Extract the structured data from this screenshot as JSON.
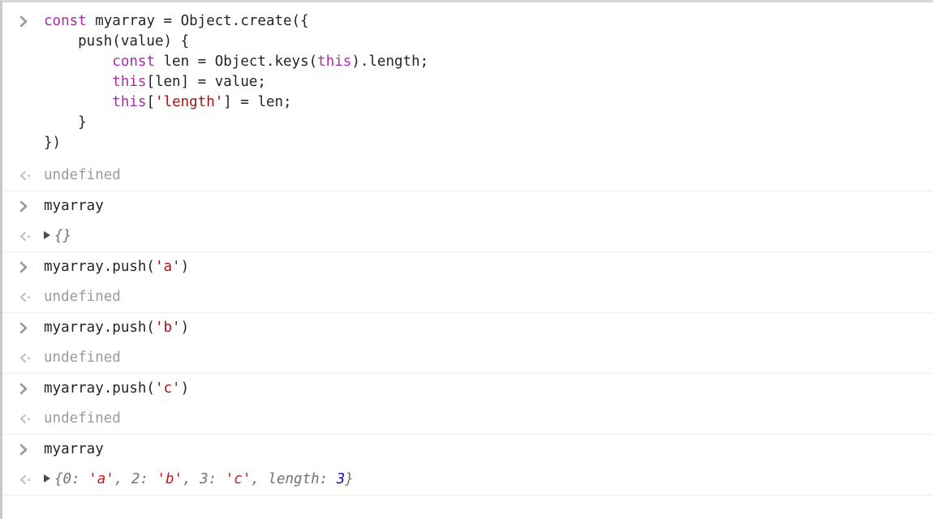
{
  "app": {
    "name": "devtools-console",
    "title": "JavaScript Console"
  },
  "markers": {
    "input": ">",
    "output": "<·",
    "input_icon": "chevron-right-icon",
    "output_icon": "chevron-left-dot-icon",
    "disclosure_icon": "disclosure-triangle-icon"
  },
  "colors": {
    "background": "#ffffff",
    "keyword": "#aa2ba5",
    "string": "#a31515",
    "number": "#1c00cf",
    "text": "#1f2328",
    "muted": "#9a9a9a",
    "separator": "#eceded",
    "result_italic": "#737373"
  },
  "entries": [
    {
      "type": "input-multiline",
      "lines": [
        {
          "segments": [
            {
              "t": "const",
              "c": "kw"
            },
            {
              "t": " myarray = Object.create({",
              "c": "plain"
            }
          ]
        },
        {
          "segments": [
            {
              "t": "    push(value) {",
              "c": "plain"
            }
          ]
        },
        {
          "segments": [
            {
              "t": "        ",
              "c": "plain"
            },
            {
              "t": "const",
              "c": "kw"
            },
            {
              "t": " len = Object.keys(",
              "c": "plain"
            },
            {
              "t": "this",
              "c": "kw"
            },
            {
              "t": ").length;",
              "c": "plain"
            }
          ]
        },
        {
          "segments": [
            {
              "t": "",
              "c": "plain"
            }
          ]
        },
        {
          "segments": [
            {
              "t": "        ",
              "c": "plain"
            },
            {
              "t": "this",
              "c": "kw"
            },
            {
              "t": "[len] = value;",
              "c": "plain"
            }
          ]
        },
        {
          "segments": [
            {
              "t": "        ",
              "c": "plain"
            },
            {
              "t": "this",
              "c": "kw"
            },
            {
              "t": "[",
              "c": "plain"
            },
            {
              "t": "'length'",
              "c": "str"
            },
            {
              "t": "] = len;",
              "c": "plain"
            }
          ]
        },
        {
          "segments": [
            {
              "t": "    }",
              "c": "plain"
            }
          ]
        },
        {
          "segments": [
            {
              "t": "})",
              "c": "plain"
            }
          ]
        }
      ]
    },
    {
      "type": "output-text",
      "text": "undefined"
    },
    {
      "type": "separator"
    },
    {
      "type": "input-single",
      "segments": [
        {
          "t": "myarray",
          "c": "plain"
        }
      ]
    },
    {
      "type": "output-object",
      "expandable": true,
      "segments": [
        {
          "t": "{}",
          "c": "res"
        }
      ]
    },
    {
      "type": "separator"
    },
    {
      "type": "input-single",
      "segments": [
        {
          "t": "myarray.push(",
          "c": "plain"
        },
        {
          "t": "'a'",
          "c": "str"
        },
        {
          "t": ")",
          "c": "plain"
        }
      ]
    },
    {
      "type": "output-text",
      "text": "undefined"
    },
    {
      "type": "separator"
    },
    {
      "type": "input-single",
      "segments": [
        {
          "t": "myarray.push(",
          "c": "plain"
        },
        {
          "t": "'b'",
          "c": "str"
        },
        {
          "t": ")",
          "c": "plain"
        }
      ]
    },
    {
      "type": "output-text",
      "text": "undefined"
    },
    {
      "type": "separator"
    },
    {
      "type": "input-single",
      "segments": [
        {
          "t": "myarray.push(",
          "c": "plain"
        },
        {
          "t": "'c'",
          "c": "str"
        },
        {
          "t": ")",
          "c": "plain"
        }
      ]
    },
    {
      "type": "output-text",
      "text": "undefined"
    },
    {
      "type": "separator"
    },
    {
      "type": "input-single",
      "segments": [
        {
          "t": "myarray",
          "c": "plain"
        }
      ]
    },
    {
      "type": "output-object",
      "expandable": true,
      "segments": [
        {
          "t": "{0: ",
          "c": "res"
        },
        {
          "t": "'a'",
          "c": "str"
        },
        {
          "t": ", 2: ",
          "c": "res"
        },
        {
          "t": "'b'",
          "c": "str"
        },
        {
          "t": ", 3: ",
          "c": "res"
        },
        {
          "t": "'c'",
          "c": "str"
        },
        {
          "t": ", length: ",
          "c": "res"
        },
        {
          "t": "3",
          "c": "num"
        },
        {
          "t": "}",
          "c": "res"
        }
      ]
    }
  ]
}
